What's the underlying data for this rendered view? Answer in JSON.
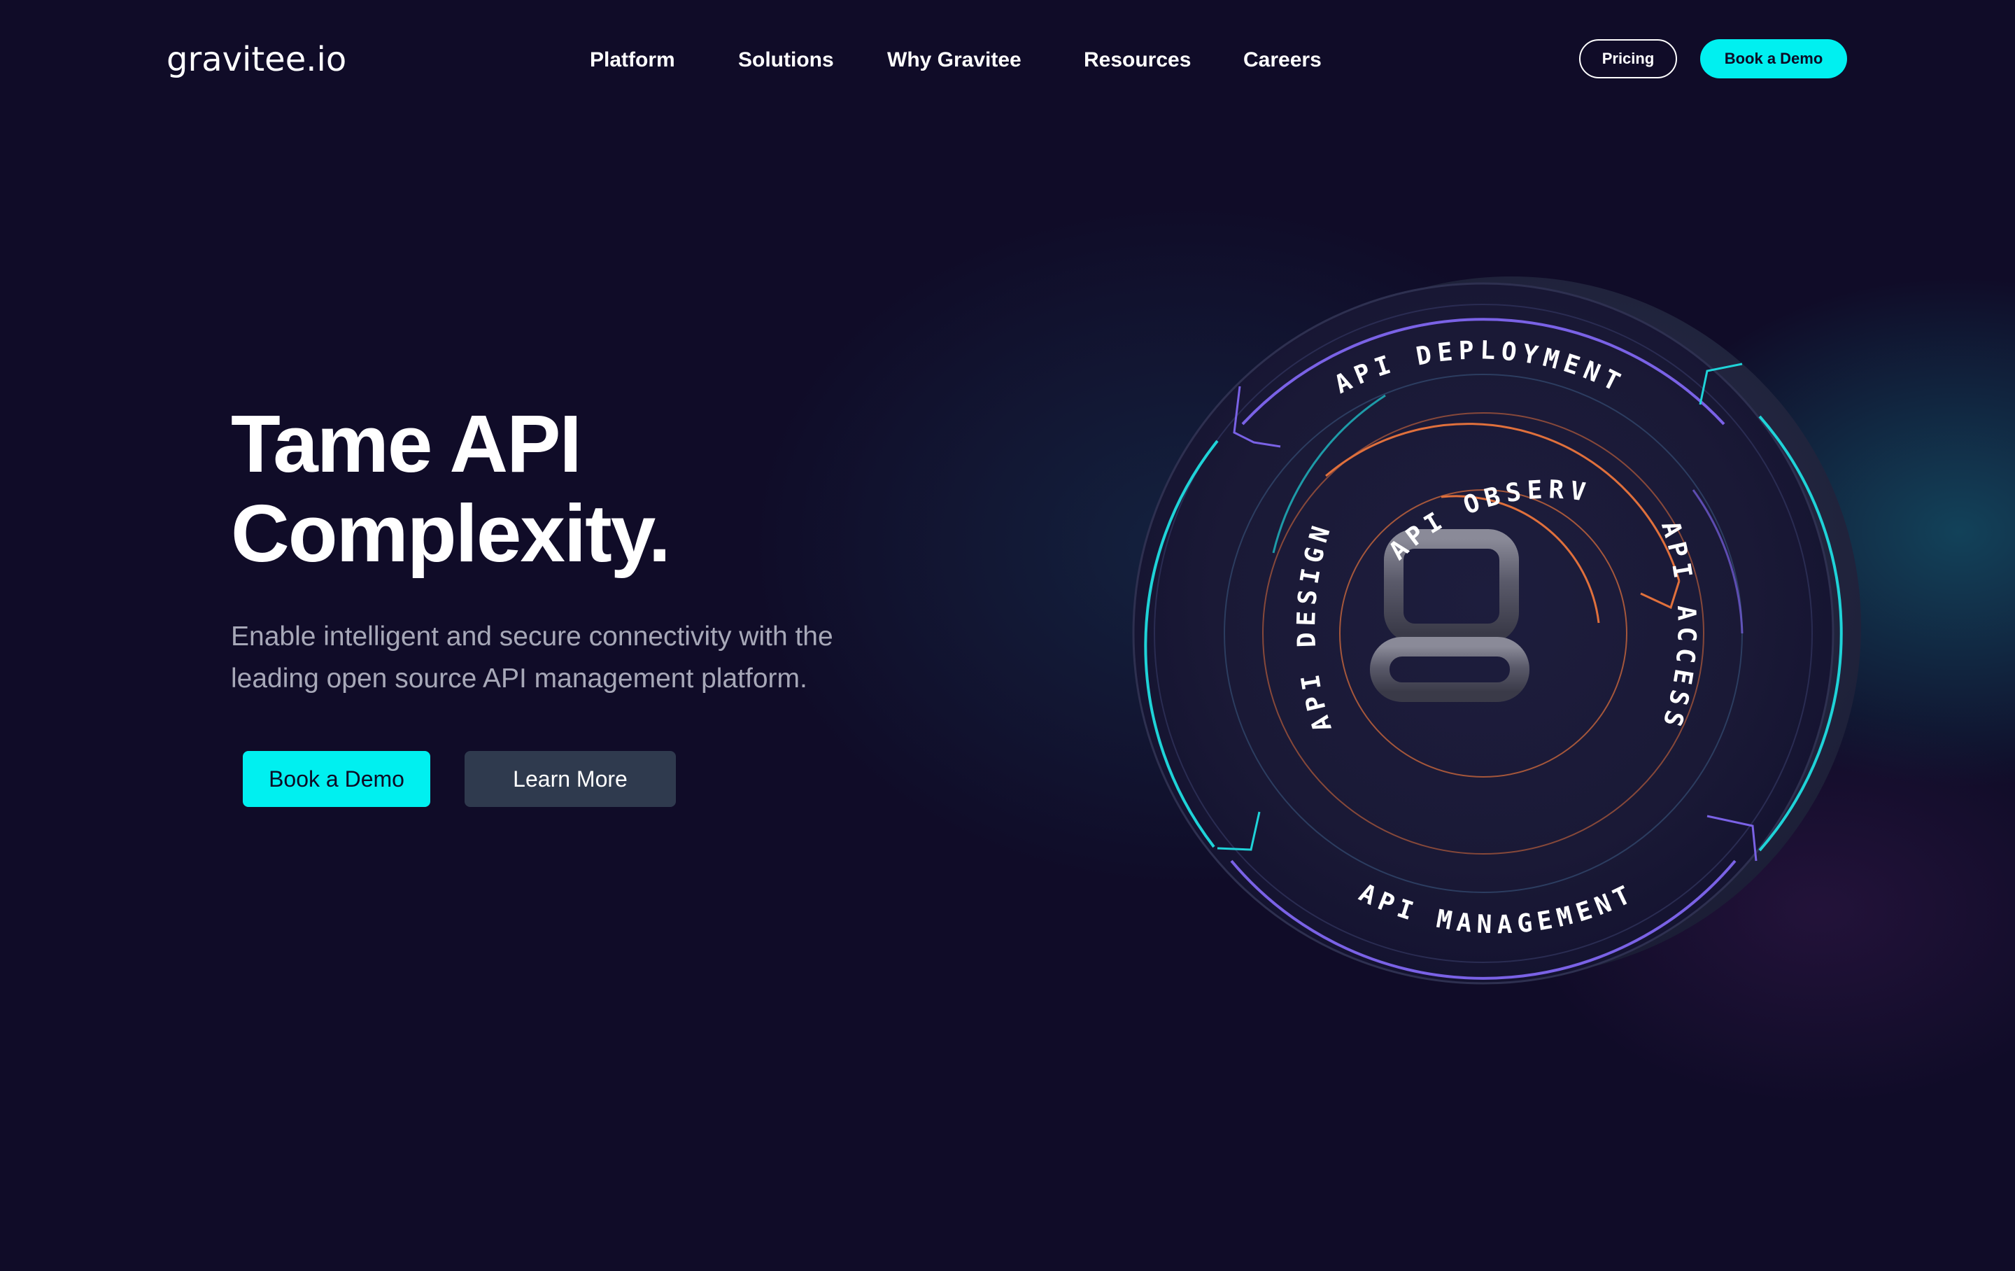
{
  "nav": {
    "logo_text": "gravitee.io",
    "items": [
      {
        "label": "Platform"
      },
      {
        "label": "Solutions"
      },
      {
        "label": "Why Gravitee"
      },
      {
        "label": "Resources"
      },
      {
        "label": "Careers"
      }
    ],
    "pricing_label": "Pricing",
    "book_demo_label": "Book a Demo"
  },
  "hero": {
    "title_line1": "Tame API",
    "title_line2": "Complexity.",
    "subtitle_line1": "Enable intelligent and secure connectivity with the",
    "subtitle_line2": "leading open source API management platform.",
    "primary_cta": "Book a Demo",
    "secondary_cta": "Learn More"
  },
  "emblem": {
    "center_letter": "g",
    "labels": {
      "deployment": "API DEPLOYMENT",
      "observability": "API OBSERVABILITY",
      "design": "API DESIGN",
      "access": "API ACCESS",
      "management": "API MANAGEMENT"
    }
  },
  "colors": {
    "background": "#100c28",
    "accent": "#00f0f0",
    "secondary_button": "#2f3a4e",
    "ring_teal": "#1fd3d8",
    "ring_violet": "#7a62e6",
    "ring_orange": "#e0703c"
  }
}
